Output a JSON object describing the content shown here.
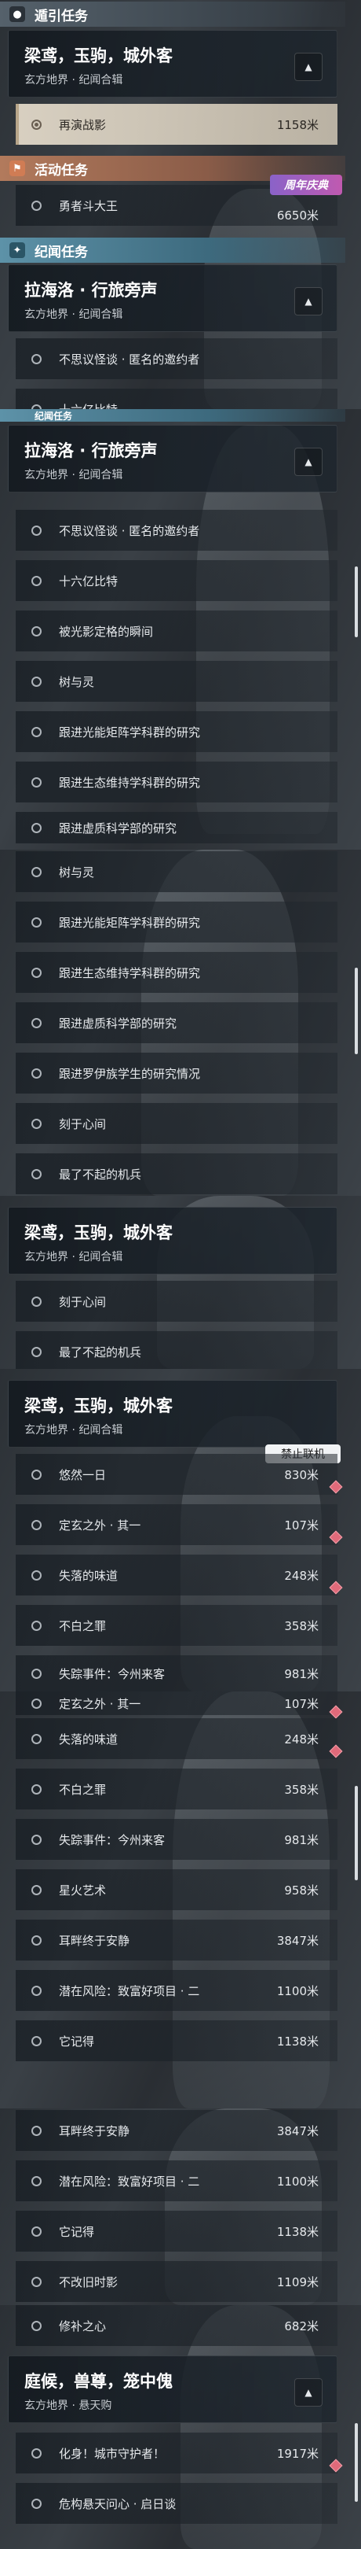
{
  "sections": {
    "guide": "遁引任务",
    "activity": "活动任务",
    "legend": "纪闻任务"
  },
  "badges": {
    "anniversary": "周年庆典",
    "no_online": "禁止联机"
  },
  "quests": {
    "lianghai": {
      "title": "梁鸢，玉驹，城外客",
      "sub": "玄方地界 · 纪闻合辑"
    },
    "lahailuo": {
      "title": "拉海洛 · 行旅旁声",
      "sub": "玄方地界 · 纪闻合辑"
    },
    "tingshou": {
      "title": "庭候，兽尊，笼中傀",
      "sub": "玄方地界 · 悬天购"
    }
  },
  "items": {
    "zaiyanzhanying": {
      "name": "再演战影",
      "dist": "1158米"
    },
    "yongzhe": {
      "name": "勇者斗大王",
      "dist": "6650米"
    },
    "busiyi": "不思议怪谈 · 匿名的邀约者",
    "shiliuyi": "十六亿比特",
    "beiguangying": "被光影定格的瞬间",
    "shuyuling": "树与灵",
    "genjin_guang": "跟进光能矩阵学科群的研究",
    "genjin_sheng": "跟进生态维持学科群的研究",
    "genjin_xuzhi": "跟进虚质科学部的研究",
    "genjin_luoyi": "跟进罗伊族学生的研究情况",
    "keyu": "刻于心间",
    "liaobuqi": "最了不起的机兵",
    "youran": {
      "name": "悠然一日",
      "dist": "830米"
    },
    "dingxuan": {
      "name": "定玄之外 · 其一",
      "dist": "107米"
    },
    "shiluo": {
      "name": "失落的味道",
      "dist": "248米"
    },
    "buzhi": {
      "name": "不白之罪",
      "dist": "358米"
    },
    "shizong": {
      "name": "失踪事件：今州来客",
      "dist": "981米"
    },
    "xinghuo": {
      "name": "星火艺术",
      "dist": "958米"
    },
    "erpan": {
      "name": "耳畔终于安静",
      "dist": "3847米"
    },
    "qianzai": {
      "name": "潜在风险：致富好项目 · 二",
      "dist": "1100米"
    },
    "tajide": {
      "name": "它记得",
      "dist": "1138米"
    },
    "bugai": {
      "name": "不改旧时影",
      "dist": "1109米"
    },
    "xiuwai": {
      "name": "修补之心",
      "dist": "682米"
    },
    "huashen": {
      "name": "化身！城市守护者！",
      "dist": "1917米"
    },
    "weijiao": {
      "name": "危构悬天问心 · 启日谈",
      "dist": ""
    }
  },
  "icons": {
    "guide": "location-pin-icon",
    "activity": "activity-flag-icon",
    "legend": "star-spark-icon",
    "collapse": "chevron-up-icon",
    "track": "diamond-marker-icon"
  }
}
